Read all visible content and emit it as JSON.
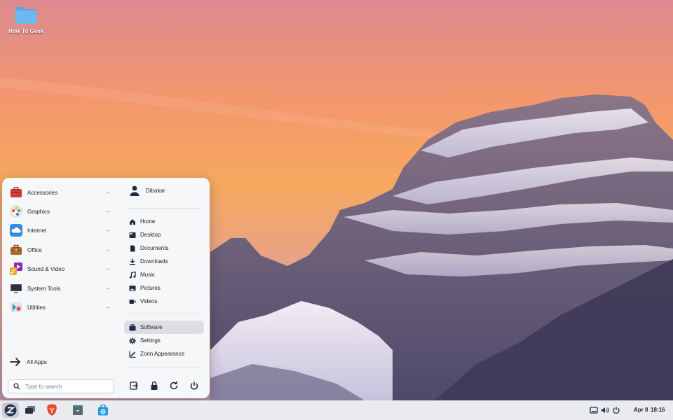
{
  "desktop": {
    "icons": [
      {
        "label": "How To Geek",
        "icon": "folder-icon"
      }
    ]
  },
  "menu": {
    "categories": [
      {
        "label": "Accessories",
        "icon": "toolbox-icon"
      },
      {
        "label": "Graphics",
        "icon": "palette-icon"
      },
      {
        "label": "Internet",
        "icon": "cloud-icon"
      },
      {
        "label": "Office",
        "icon": "briefcase-icon"
      },
      {
        "label": "Sound & Video",
        "icon": "music-video-icon"
      },
      {
        "label": "System Tools",
        "icon": "monitor-icon"
      },
      {
        "label": "Utilities",
        "icon": "utilities-icon"
      }
    ],
    "all_apps": "All Apps",
    "search_placeholder": "Type to search",
    "user": {
      "name": "Dibakar"
    },
    "places": [
      {
        "label": "Home",
        "icon": "home-icon"
      },
      {
        "label": "Desktop",
        "icon": "desktop-icon"
      },
      {
        "label": "Documents",
        "icon": "document-icon"
      },
      {
        "label": "Downloads",
        "icon": "download-icon"
      },
      {
        "label": "Music",
        "icon": "music-note-icon"
      },
      {
        "label": "Pictures",
        "icon": "picture-icon"
      },
      {
        "label": "Videos",
        "icon": "video-icon"
      }
    ],
    "system": [
      {
        "label": "Software",
        "icon": "software-icon",
        "active": true
      },
      {
        "label": "Settings",
        "icon": "gear-icon"
      },
      {
        "label": "Zorin Appearance",
        "icon": "appearance-icon"
      }
    ],
    "session_buttons": [
      "logout-icon",
      "lock-icon",
      "restart-icon",
      "power-icon"
    ]
  },
  "taskbar": {
    "apps": [
      "zorin-menu-icon",
      "workspace-switcher-icon",
      "brave-browser-icon",
      "files-icon",
      "software-store-icon"
    ],
    "tray": [
      "screen-icon",
      "volume-icon",
      "power-icon"
    ],
    "date": "Apr 8",
    "time": "18:16"
  },
  "colors": {
    "accent": "#1f77d2",
    "menu_bg": "#f6f7f9",
    "taskbar_bg": "#e9ebee"
  }
}
